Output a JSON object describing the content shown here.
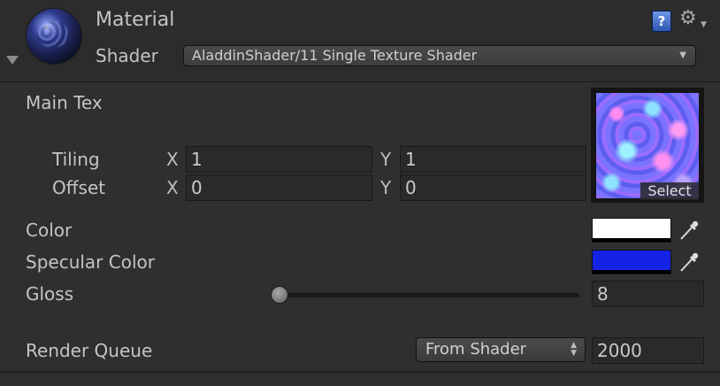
{
  "header": {
    "title": "Material",
    "shader_label": "Shader",
    "shader_value": "AladdinShader/11 Single Texture Shader",
    "help_icon_text": "?",
    "icons": {
      "help": "help-icon",
      "settings": "gear-icon",
      "foldout": "foldout-triangle-icon"
    }
  },
  "main_tex": {
    "label": "Main Tex",
    "tiling": {
      "label": "Tiling",
      "x_label": "X",
      "x": "1",
      "y_label": "Y",
      "y": "1"
    },
    "offset": {
      "label": "Offset",
      "x_label": "X",
      "x": "0",
      "y_label": "Y",
      "y": "0"
    },
    "select_label": "Select"
  },
  "color": {
    "label": "Color",
    "value": "#ffffff"
  },
  "specular": {
    "label": "Specular Color",
    "value": "#1422e6"
  },
  "gloss": {
    "label": "Gloss",
    "value": "8",
    "slider_fraction": 0.0
  },
  "render_queue": {
    "label": "Render Queue",
    "mode": "From Shader",
    "value": "2000"
  },
  "colors": {
    "panel": "#2f2f2f",
    "field": "#2a2a2a",
    "text": "#c4c4c4"
  }
}
